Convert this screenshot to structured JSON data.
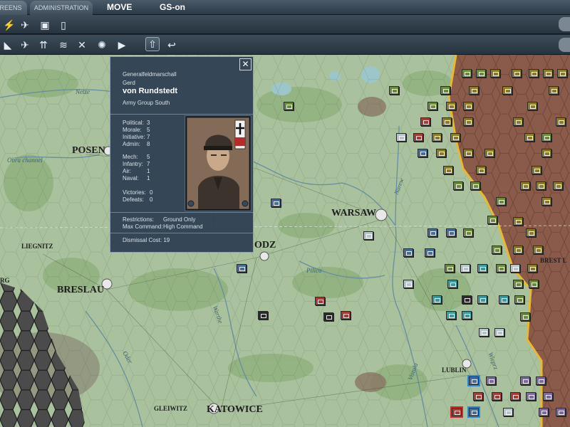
{
  "tabs": {
    "screens": "REENS",
    "administration": "ADMINISTRATION"
  },
  "status": {
    "move": "MOVE",
    "gs": "GS-on"
  },
  "toolbar1": [
    {
      "name": "satellite-supply-icon",
      "glyph": "⚡"
    },
    {
      "name": "strike-icon",
      "glyph": "✈"
    },
    {
      "name": "card-icon",
      "glyph": "▣"
    },
    {
      "name": "phone-icon",
      "glyph": "▯"
    }
  ],
  "toolbar2": [
    {
      "name": "rail-icon",
      "glyph": "◣"
    },
    {
      "name": "air-icon",
      "glyph": "✈"
    },
    {
      "name": "artillery-icon",
      "glyph": "⇈"
    },
    {
      "name": "signal-icon",
      "glyph": "≋"
    },
    {
      "name": "paradrop-icon",
      "glyph": "✕"
    },
    {
      "name": "explosion-icon",
      "glyph": "✺"
    },
    {
      "name": "next-icon",
      "glyph": "▶"
    },
    {
      "name": "upload-icon",
      "glyph": "⇧"
    },
    {
      "name": "undo-icon",
      "glyph": "↩"
    }
  ],
  "leader": {
    "rank": "Generalfeldmarschall",
    "first_name": "Gerd",
    "surname": "von Rundstedt",
    "army_group": "Army Group South",
    "close": "✕",
    "stats": [
      {
        "label": "Political:",
        "value": "3"
      },
      {
        "label": "Morale:",
        "value": "5"
      },
      {
        "label": "Initiative:",
        "value": "7"
      },
      {
        "label": "Admin:",
        "value": "8"
      }
    ],
    "combat": [
      {
        "label": "Mech:",
        "value": "5"
      },
      {
        "label": "Infantry:",
        "value": "7"
      },
      {
        "label": "Air:",
        "value": "1"
      },
      {
        "label": "Naval:",
        "value": "1"
      }
    ],
    "record": [
      {
        "label": "Victories:",
        "value": "0"
      },
      {
        "label": "Defeats:",
        "value": "0"
      }
    ],
    "restrictions_label": "Restrictions:",
    "restrictions_value": "Ground Only",
    "max_command_label": "Max Command:",
    "max_command_value": "High Command",
    "dismissal_label": "Dismissal Cost:",
    "dismissal_value": "19"
  },
  "cities": {
    "posen": "POSEN",
    "warsaw": "WARSAW",
    "liegnitz": "LIEGNITZ",
    "breslau": "BRESLAU",
    "lodz": "ODZ",
    "lublin": "LUBLIN",
    "gleiwitz": "GLEIWITZ",
    "katowice": "KATOWICE",
    "brest": "BREST L",
    "rg": "RG"
  },
  "rivers": {
    "netze": "Netze",
    "obra": "Obra channel",
    "pilica": "Pilica",
    "warthe": "Warthe",
    "oder": "Oder",
    "vistula": "Vistula",
    "wieprz": "Wieprz",
    "narew": "Narew"
  },
  "colors": {
    "map_base": "#a9c19c",
    "soviet_territory": "#8a5a4a",
    "front_line": "#e8b930",
    "panel_bg": "#2e4052"
  }
}
